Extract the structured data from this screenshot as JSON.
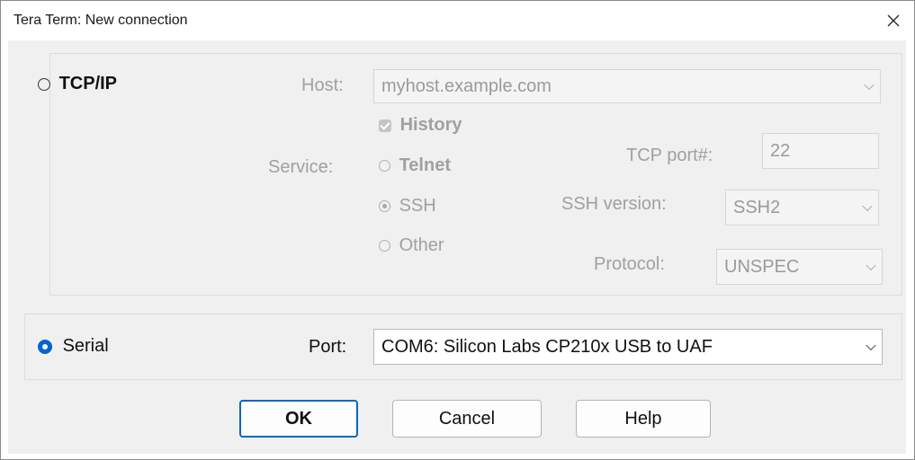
{
  "window": {
    "title": "Tera Term: New connection"
  },
  "tcpip": {
    "radio_label": "TCP/IP",
    "host_label": "Host:",
    "host_value": "myhost.example.com",
    "history_label": "History",
    "history_checked": true,
    "service_label": "Service:",
    "services": [
      "Telnet",
      "SSH",
      "Other"
    ],
    "selected_service": "SSH",
    "tcp_port_label": "TCP port#:",
    "tcp_port_value": "22",
    "ssh_version_label": "SSH version:",
    "ssh_version_value": "SSH2",
    "protocol_label": "Protocol:",
    "protocol_value": "UNSPEC"
  },
  "serial": {
    "radio_label": "Serial",
    "selected": true,
    "port_label": "Port:",
    "port_value": "COM6: Silicon Labs CP210x USB to UAF"
  },
  "buttons": {
    "ok": "OK",
    "cancel": "Cancel",
    "help": "Help"
  },
  "colors": {
    "accent": "#0066cc",
    "disabled_text": "#a0a0a0",
    "dialog_bg": "#f0f0f0"
  }
}
